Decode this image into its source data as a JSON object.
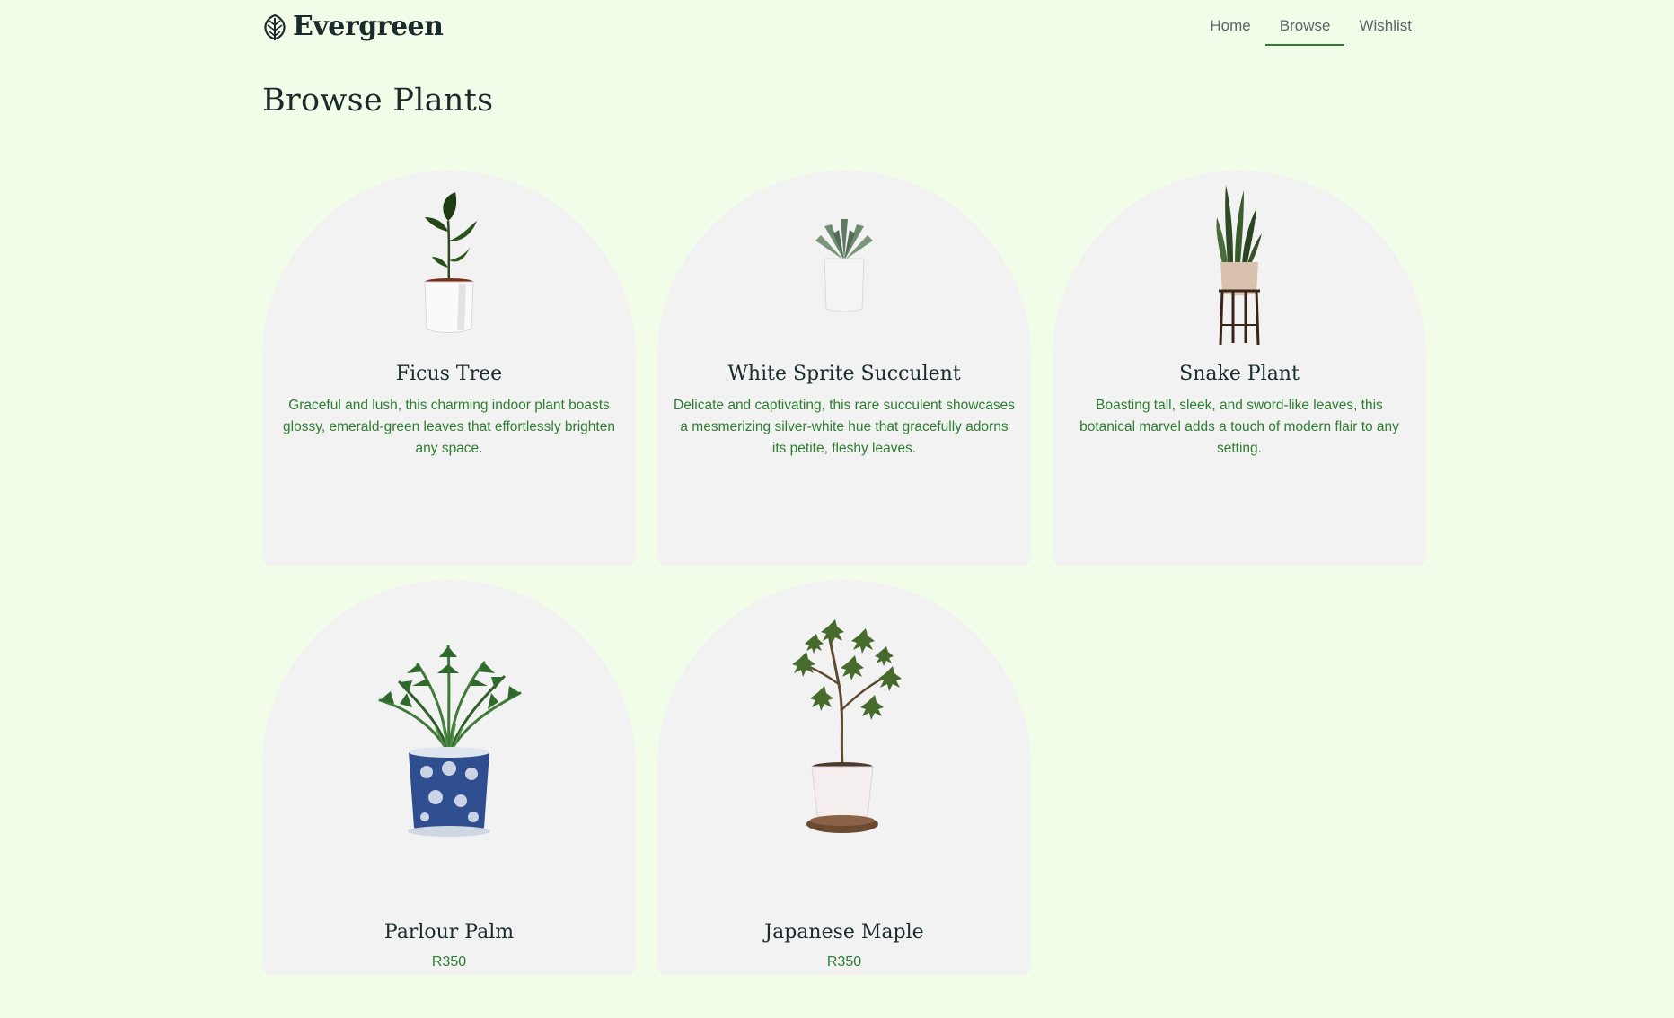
{
  "brand": {
    "name": "Evergreen",
    "icon": "leaf-icon"
  },
  "nav": [
    {
      "label": "Home",
      "active": false
    },
    {
      "label": "Browse",
      "active": true
    },
    {
      "label": "Wishlist",
      "active": false
    }
  ],
  "page": {
    "title": "Browse Plants"
  },
  "plants": [
    {
      "name": "Ficus Tree",
      "description": "Graceful and lush, this charming indoor plant boasts glossy, emerald-green leaves that effortlessly brighten any space.",
      "price": ""
    },
    {
      "name": "White Sprite Succulent",
      "description": "Delicate and captivating, this rare succulent showcases a mesmerizing silver-white hue that gracefully adorns its petite, fleshy leaves.",
      "price": ""
    },
    {
      "name": "Snake Plant",
      "description": "Boasting tall, sleek, and sword-like leaves, this botanical marvel adds a touch of modern flair to any setting.",
      "price": ""
    },
    {
      "name": "Parlour Palm",
      "description": "",
      "price": "R350"
    },
    {
      "name": "Japanese Maple",
      "description": "",
      "price": "R350"
    }
  ],
  "colors": {
    "background": "#f2fde9",
    "card": "#f2f2f2",
    "accent": "#2e7d32",
    "heading": "#1b2a2b"
  }
}
